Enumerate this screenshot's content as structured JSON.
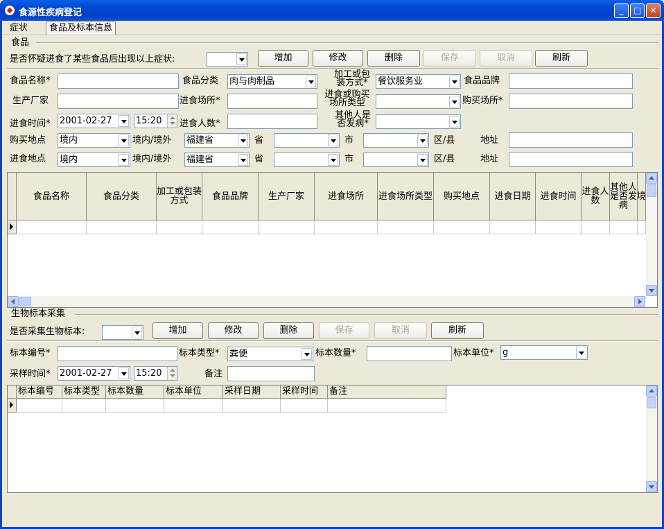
{
  "window": {
    "title": "食源性疾病登记"
  },
  "tabs": [
    {
      "label": "症状"
    },
    {
      "label": "食品及标本信息"
    }
  ],
  "food": {
    "section_title": "食品",
    "question": "是否怀疑进食了某些食品后出现以上症状:",
    "question_value": "",
    "buttons": {
      "add": "增加",
      "edit": "修改",
      "delete": "删除",
      "save": "保存",
      "cancel": "取消",
      "refresh": "刷新"
    },
    "labels": {
      "name": "食品名称*",
      "category": "食品分类",
      "packaging_1": "加工或包",
      "packaging_2": "装方式*",
      "brand": "食品品牌",
      "manufacturer": "生产厂家",
      "eat_place": "进食场所*",
      "place_type_1": "进食或购买",
      "place_type_2": "场所类型",
      "buy_place": "购买场所*",
      "eat_time": "进食时间*",
      "eat_count": "进食人数*",
      "others_sick_1": "其他人是",
      "others_sick_2": "否发病*",
      "buy_location": "购买地点",
      "eat_location": "进食地点",
      "domestic": "境内/境外",
      "province": "省",
      "city": "市",
      "district": "区/县",
      "address": "地址"
    },
    "values": {
      "name": "",
      "category": "肉与肉制品",
      "packaging": "餐饮服务业",
      "brand": "",
      "manufacturer": "",
      "eat_place": "",
      "place_type": "",
      "buy_place": "",
      "eat_date": "2001-02-27",
      "eat_time": "15:20",
      "eat_count": "",
      "others_sick": "",
      "buy_loc_scope": "境内",
      "buy_loc_province": "福建省",
      "buy_loc_prov_sel": "",
      "buy_loc_city": "",
      "buy_loc_address": "",
      "eat_loc_scope": "境内",
      "eat_loc_province": "福建省",
      "eat_loc_prov_sel": "",
      "eat_loc_city": "",
      "eat_loc_address": ""
    },
    "table": {
      "columns": [
        "食品名称",
        "食品分类",
        "加工或包装方式",
        "食品品牌",
        "生产厂家",
        "进食场所",
        "进食场所类型",
        "购买地点",
        "进食日期",
        "进食时间",
        "进食人数",
        "其他人是否发病",
        "境"
      ]
    }
  },
  "specimen": {
    "section_title": "生物标本采集",
    "question": "是否采集生物标本:",
    "question_value": "",
    "buttons": {
      "add": "增加",
      "edit": "修改",
      "delete": "删除",
      "save": "保存",
      "cancel": "取消",
      "refresh": "刷新"
    },
    "labels": {
      "id": "标本编号*",
      "type": "标本类型*",
      "qty": "标本数量*",
      "unit": "标本单位*",
      "time": "采样时间*",
      "note": "备注"
    },
    "values": {
      "id": "",
      "type": "粪便",
      "qty": "",
      "unit": "g",
      "date": "2001-02-27",
      "time": "15:20",
      "note": ""
    },
    "table": {
      "columns": [
        "标本编号",
        "标本类型",
        "标本数量",
        "标本单位",
        "采样日期",
        "采样时间",
        "备注"
      ]
    }
  }
}
